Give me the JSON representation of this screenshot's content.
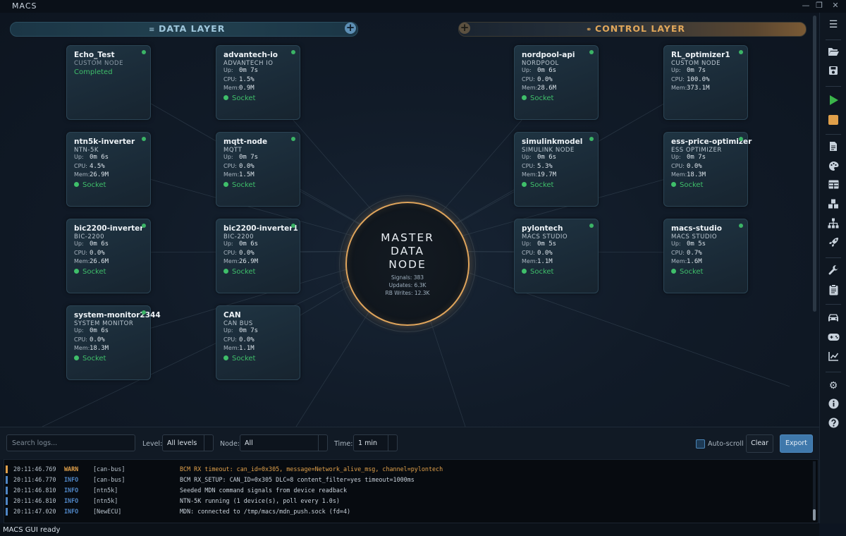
{
  "app": {
    "title": "MACS"
  },
  "window": {
    "minimize": "—",
    "maximize": "❐",
    "close": "✕"
  },
  "layers": {
    "data": {
      "label": "DATA LAYER",
      "icon": "≡",
      "add": "+"
    },
    "control": {
      "label": "CONTROL LAYER",
      "icon": "⚭",
      "add": "+"
    }
  },
  "nodes": [
    {
      "title": "Echo_Test",
      "type": "CUSTOM NODE",
      "completed": "Completed"
    },
    {
      "title": "advantech-io",
      "type": "ADVANTECH IO",
      "up_k": "Up:",
      "up": "0m 7s",
      "cpu_k": "CPU:",
      "cpu": "1.5%",
      "mem_k": "Mem:",
      "mem": "0.9M",
      "conn": "Socket"
    },
    {
      "title": "ntn5k-inverter",
      "type": "NTN-5K",
      "up_k": "Up:",
      "up": "0m 6s",
      "cpu_k": "CPU:",
      "cpu": "4.5%",
      "mem_k": "Mem:",
      "mem": "26.9M",
      "conn": "Socket"
    },
    {
      "title": "mqtt-node",
      "type": "MQTT",
      "up_k": "Up:",
      "up": "0m 7s",
      "cpu_k": "CPU:",
      "cpu": "0.0%",
      "mem_k": "Mem:",
      "mem": "1.5M",
      "conn": "Socket"
    },
    {
      "title": "bic2200-inverter",
      "type": "BIC-2200",
      "up_k": "Up:",
      "up": "0m 6s",
      "cpu_k": "CPU:",
      "cpu": "0.0%",
      "mem_k": "Mem:",
      "mem": "26.6M",
      "conn": "Socket"
    },
    {
      "title": "bic2200-inverter1",
      "type": "BIC-2200",
      "up_k": "Up:",
      "up": "0m 6s",
      "cpu_k": "CPU:",
      "cpu": "0.0%",
      "mem_k": "Mem:",
      "mem": "26.9M",
      "conn": "Socket"
    },
    {
      "title": "system-monitor2344",
      "type": "SYSTEM MONITOR",
      "up_k": "Up:",
      "up": "0m 6s",
      "cpu_k": "CPU:",
      "cpu": "0.0%",
      "mem_k": "Mem:",
      "mem": "18.3M",
      "conn": "Socket"
    },
    {
      "title": "CAN",
      "type": "CAN BUS",
      "up_k": "Up:",
      "up": "0m 7s",
      "cpu_k": "CPU:",
      "cpu": "0.0%",
      "mem_k": "Mem:",
      "mem": "1.1M",
      "conn": "Socket"
    },
    {
      "title": "nordpool-api",
      "type": "NORDPOOL",
      "up_k": "Up:",
      "up": "0m 6s",
      "cpu_k": "CPU:",
      "cpu": "0.0%",
      "mem_k": "Mem:",
      "mem": "28.6M",
      "conn": "Socket"
    },
    {
      "title": "RL_optimizer1",
      "type": "CUSTOM NODE",
      "up_k": "Up:",
      "up": "0m 7s",
      "cpu_k": "CPU:",
      "cpu": "100.0%",
      "mem_k": "Mem:",
      "mem": "373.1M"
    },
    {
      "title": "simulinkmodel",
      "type": "SIMULINK NODE",
      "up_k": "Up:",
      "up": "0m 6s",
      "cpu_k": "CPU:",
      "cpu": "5.3%",
      "mem_k": "Mem:",
      "mem": "19.7M",
      "conn": "Socket"
    },
    {
      "title": "ess-price-optimizer",
      "type": "ESS OPTIMIZER",
      "up_k": "Up:",
      "up": "0m 7s",
      "cpu_k": "CPU:",
      "cpu": "0.0%",
      "mem_k": "Mem:",
      "mem": "18.3M",
      "conn": "Socket"
    },
    {
      "title": "pylontech",
      "type": "MACS STUDIO",
      "up_k": "Up:",
      "up": "0m 5s",
      "cpu_k": "CPU:",
      "cpu": "0.0%",
      "mem_k": "Mem:",
      "mem": "1.1M",
      "conn": "Socket"
    },
    {
      "title": "macs-studio",
      "type": "MACS STUDIO",
      "up_k": "Up:",
      "up": "0m 5s",
      "cpu_k": "CPU:",
      "cpu": "0.7%",
      "mem_k": "Mem:",
      "mem": "1.6M",
      "conn": "Socket"
    }
  ],
  "master": {
    "line1": "MASTER",
    "line2": "DATA",
    "line3": "NODE",
    "signals": "Signals: 383",
    "updates": "Updates: 6.3K",
    "writes": "RB Writes: 12.3K"
  },
  "logs_toolbar": {
    "search_placeholder": "Search logs...",
    "level_label": "Level:",
    "level_value": "All levels",
    "node_label": "Node:",
    "node_value": "All",
    "time_label": "Time:",
    "time_value": "1 min",
    "autoscroll_label": "Auto-scroll",
    "clear_label": "Clear",
    "export_label": "Export"
  },
  "logs": [
    {
      "time": "20:11:46.769",
      "level": "WARN",
      "source": "[can-bus]",
      "message": "BCM RX timeout: can_id=0x305, message=Network_alive_msg, channel=pylontech"
    },
    {
      "time": "20:11:46.770",
      "level": "INFO",
      "source": "[can-bus]",
      "message": "BCM RX_SETUP: CAN_ID=0x305 DLC=8 content_filter=yes timeout=1000ms"
    },
    {
      "time": "20:11:46.810",
      "level": "INFO",
      "source": "[ntn5k]",
      "message": "Seeded MDN command signals from device readback"
    },
    {
      "time": "20:11:46.810",
      "level": "INFO",
      "source": "[ntn5k]",
      "message": "NTN-5K running (1 device(s), poll every 1.0s)"
    },
    {
      "time": "20:11:47.020",
      "level": "INFO",
      "source": "[NewECU]",
      "message": "MDN: connected to /tmp/macs/mdn_push.sock (fd=4)"
    }
  ],
  "colors": {
    "warn": "#e0a04a",
    "info": "#4f86c6",
    "accent": "#e0a55c",
    "ok": "#3fbf6a"
  },
  "sidebar_icons": [
    "menu-icon",
    "folder-open-icon",
    "save-icon",
    "play-icon",
    "stop-icon",
    "document-icon",
    "palette-icon",
    "table-icon",
    "cubes-icon",
    "network-icon",
    "rocket-icon",
    "wrench-icon",
    "clipboard-icon",
    "car-icon",
    "gamepad-icon",
    "chart-line-icon",
    "gear-icon",
    "info-icon",
    "help-icon"
  ],
  "status": {
    "text": "MACS GUI ready"
  }
}
